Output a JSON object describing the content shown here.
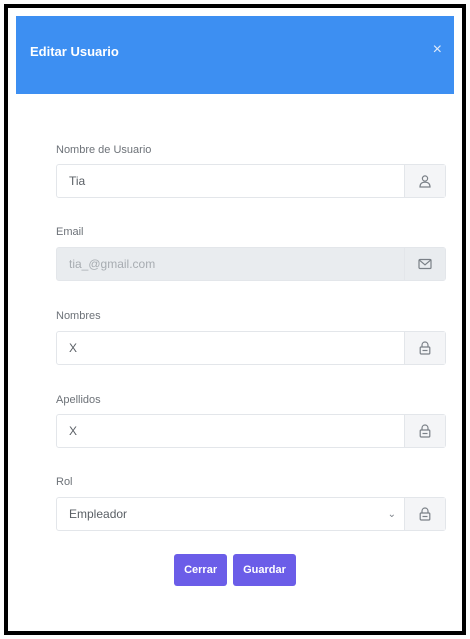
{
  "modal": {
    "title": "Editar Usuario",
    "close_label": "×"
  },
  "fields": {
    "username": {
      "label": "Nombre de Usuario",
      "value": "Tia"
    },
    "email": {
      "label": "Email",
      "value": "tia_@gmail.com"
    },
    "names": {
      "label": "Nombres",
      "value": "X"
    },
    "surnames": {
      "label": "Apellidos",
      "value": "X"
    },
    "role": {
      "label": "Rol",
      "value": "Empleador"
    }
  },
  "buttons": {
    "close": "Cerrar",
    "save": "Guardar"
  },
  "icons": {
    "username": "user-icon",
    "email": "envelope-icon",
    "names": "lock-icon",
    "surnames": "lock-icon",
    "role": "lock-icon"
  },
  "colors": {
    "header": "#3d8ff2",
    "button": "#6b5de8",
    "disabled_bg": "#e9ecef"
  }
}
